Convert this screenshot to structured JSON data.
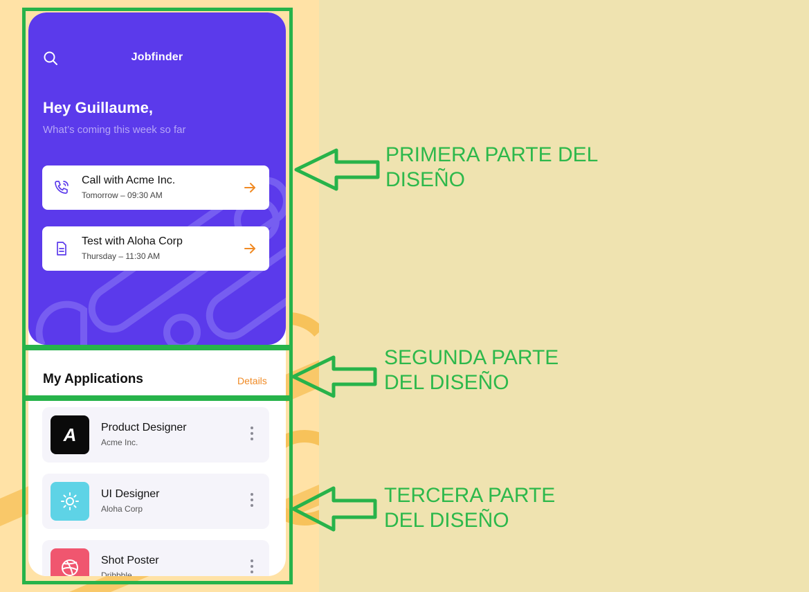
{
  "app": {
    "title": "Jobfinder",
    "greeting": "Hey Guillaume,",
    "subtitle": "What’s coming this week so far"
  },
  "events": [
    {
      "title": "Call with Acme Inc.",
      "time": "Tomorrow – 09:30 AM",
      "icon": "phone-icon"
    },
    {
      "title": "Test with Aloha Corp",
      "time": "Thursday – 11:30 AM",
      "icon": "document-icon"
    }
  ],
  "applications": {
    "title": "My Applications",
    "details_label": "Details",
    "items": [
      {
        "job": "Product Designer",
        "company": "Acme Inc.",
        "logo_text": "A",
        "logo_bg": "#0A0A0A"
      },
      {
        "job": "UI Designer",
        "company": "Aloha Corp",
        "logo_bg": "#5ED3E6"
      },
      {
        "job": "Shot Poster",
        "company": "Dribbble",
        "logo_bg": "#F0566F"
      }
    ]
  },
  "annotations": [
    {
      "line1": "PRIMERA PARTE DEL",
      "line2": "DISEÑO"
    },
    {
      "line1": "SEGUNDA PARTE",
      "line2": "DEL DISEÑO"
    },
    {
      "line1": "TERCERA PARTE",
      "line2": "DEL DISEÑO"
    }
  ],
  "colors": {
    "hero": "#5B3AEB",
    "accent_orange": "#F08A24",
    "annotation_green": "#27B34A",
    "page_bg": "#EFE3B0"
  }
}
